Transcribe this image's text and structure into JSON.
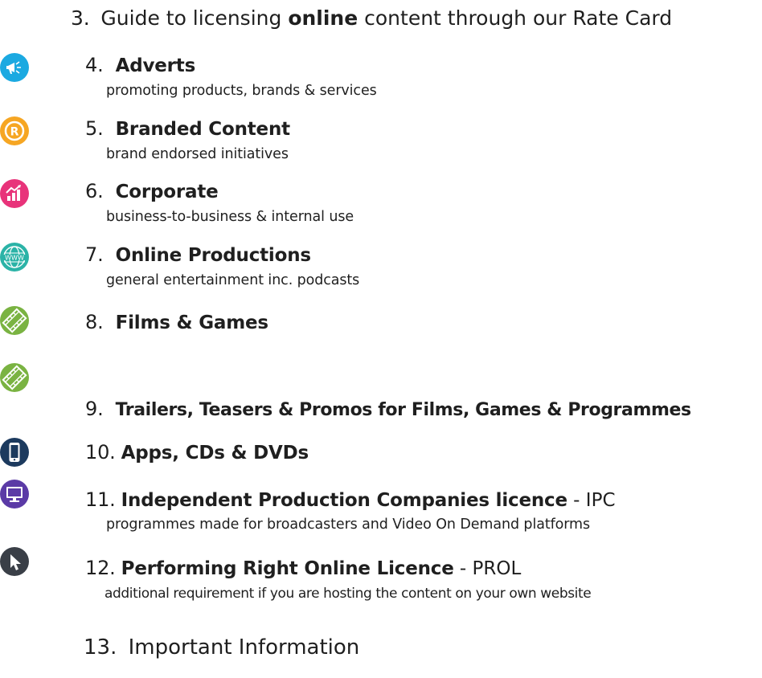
{
  "header": {
    "number": "3.",
    "prefix": "Guide to licensing ",
    "emphasis": "online",
    "suffix": " content through our Rate Card"
  },
  "items": [
    {
      "number": "4.",
      "title": "Adverts",
      "subtitle": "promoting products, brands & services",
      "icon": "megaphone-icon",
      "color": "#1ba9e1"
    },
    {
      "number": "5.",
      "title": "Branded Content",
      "subtitle": "brand endorsed initiatives",
      "icon": "registered-mark-icon",
      "color": "#f6a623"
    },
    {
      "number": "6.",
      "title": "Corporate",
      "subtitle": "business-to-business & internal use",
      "icon": "growth-chart-icon",
      "color": "#e8337a"
    },
    {
      "number": "7.",
      "title": "Online Productions",
      "subtitle": "general entertainment inc. podcasts",
      "icon": "www-globe-icon",
      "color": "#2bb3a7"
    },
    {
      "number": "8.",
      "title": "Films & Games",
      "subtitle": "",
      "icon": "film-strip-icon",
      "color": "#7ab342"
    },
    {
      "number": "9.",
      "title": "Trailers, Teasers & Promos for Films, Games & Programmes",
      "subtitle": "",
      "icon": "film-strip-icon",
      "color": "#7ab342"
    },
    {
      "number": "10.",
      "title": "Apps, CDs & DVDs",
      "subtitle": "",
      "icon": "smartphone-icon",
      "color": "#1c3a5e"
    },
    {
      "number": "11.",
      "title": "Independent Production Companies licence",
      "suffix": " - IPC",
      "subtitle": "programmes made for broadcasters and Video On Demand platforms",
      "icon": "monitor-icon",
      "color": "#5b3aa6"
    },
    {
      "number": "12.",
      "title": "Performing Right Online Licence",
      "suffix": " - PROL",
      "subtitle": "additional requirement if you are hosting the content on your own website",
      "icon": "cursor-arrow-icon",
      "color": "#3a3f47"
    }
  ],
  "footer": {
    "number": "13.",
    "text": "Important Information"
  }
}
